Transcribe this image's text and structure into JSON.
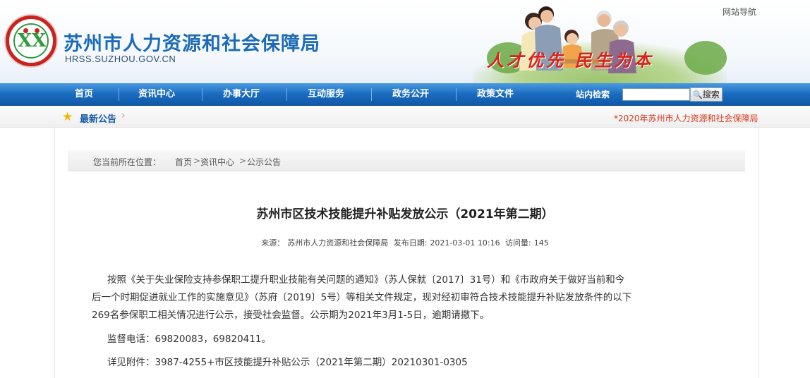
{
  "header": {
    "site_title": "苏州市人力资源和社会保障局",
    "site_domain": "HRSS.SUZHOU.GOV.CN",
    "site_nav_link": "网站导航",
    "slogan": "人才优先 民生为本",
    "brand_color": "#1c6bb8",
    "slogan_color": "#d8231a"
  },
  "nav": {
    "items": [
      {
        "label": "首页"
      },
      {
        "label": "资讯中心"
      },
      {
        "label": "办事大厅"
      },
      {
        "label": "互动服务"
      },
      {
        "label": "政务公开"
      },
      {
        "label": "政策文件"
      }
    ],
    "search_label": "站内检索",
    "search_value": "",
    "search_button": "搜索",
    "bar_color": "#1a6bbf"
  },
  "notice": {
    "label": "最新公告",
    "scroll_text": "*2020年苏州市人力资源和社会保障局"
  },
  "breadcrumb": {
    "prefix": "您当前所在位置：",
    "items": [
      "首页",
      "资讯中心",
      "公示公告"
    ],
    "separator": ">"
  },
  "article": {
    "title": "苏州市区技术技能提升补贴发放公示（2021年第二期）",
    "meta": {
      "source_label": "来源：",
      "source": "苏州市人力资源和社会保障局",
      "date_label": "发布日期:",
      "date": "2021-03-01 10:16",
      "views_label": "访问量:",
      "views": "145"
    },
    "body_lines": [
      "按照《关于失业保险支持参保职工提升职业技能有关问题的通知》（苏人保就〔2017〕31号）和《市政府关于做好当前和今",
      "后一个时期促进就业工作的实施意见》（苏府〔2019〕5号）等相关文件规定，现对经初审符合技术技能提升补贴发放条件的以下",
      "269名参保职工相关情况进行公示，接受社会监督。公示期为2021年3月1-5日，逾期请撤下。"
    ],
    "phone_label": "监督电话：",
    "phone": "69820083，69820411。",
    "attachment_label": "详见附件：",
    "attachment": "3987-4255+市区技能提升补贴公示（2021年第二期）20210301-0305"
  }
}
